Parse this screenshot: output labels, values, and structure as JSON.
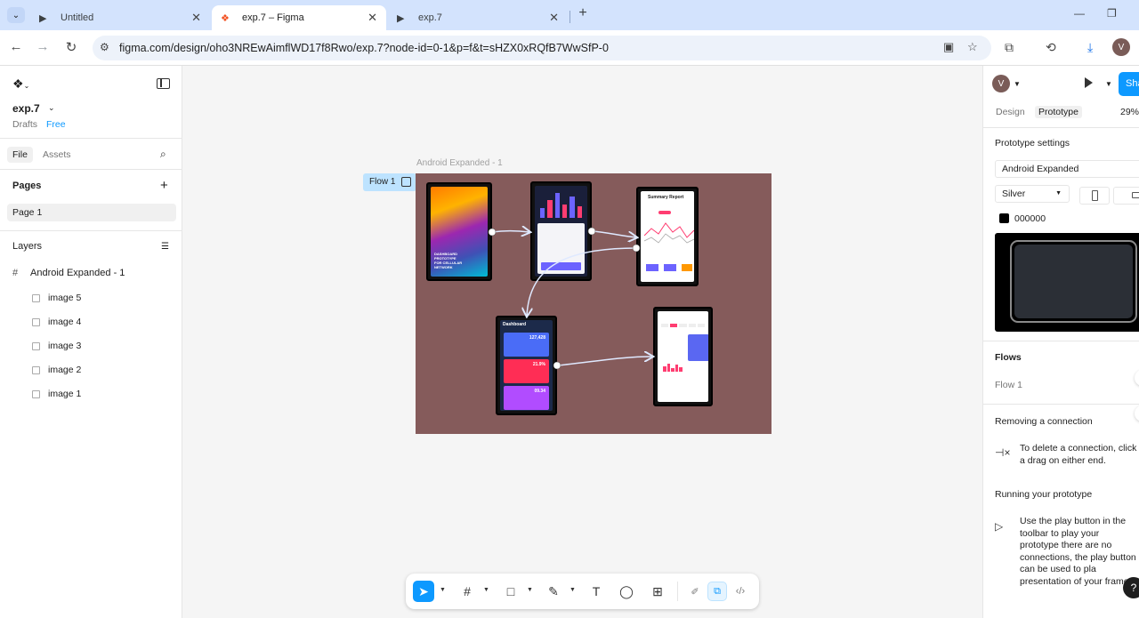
{
  "browser": {
    "tabs": [
      {
        "title": "Untitled",
        "icon": "play-icon"
      },
      {
        "title": "exp.7 – Figma",
        "icon": "figma-icon"
      },
      {
        "title": "exp.7",
        "icon": "play-icon"
      }
    ],
    "url": "figma.com/design/oho3NREwAimflWD17f8Rwo/exp.7?node-id=0-1&p=f&t=sHZX0xRQfB7WwSfP-0",
    "profile_initial": "V"
  },
  "left_panel": {
    "file_name": "exp.7",
    "drafts_label": "Drafts",
    "plan_label": "Free",
    "tabs": {
      "file": "File",
      "assets": "Assets"
    },
    "pages_title": "Pages",
    "pages": [
      "Page 1"
    ],
    "layers_title": "Layers",
    "frame_layer": "Android Expanded - 1",
    "layers": [
      "image 5",
      "image 4",
      "image 3",
      "image 2",
      "image 1"
    ]
  },
  "canvas": {
    "frame_label": "Android Expanded - 1",
    "flow_badge": "Flow 1",
    "frame_color": "#855b5b",
    "screens": {
      "summary_title": "Summary Report",
      "dashboard_title": "Dashboard",
      "dashboard_values": [
        "127,428",
        "21.9%",
        "09.34"
      ]
    }
  },
  "toolbar": {
    "tools": [
      "move-tool",
      "frame-tool",
      "shape-tool",
      "pen-tool",
      "text-tool",
      "comment-tool",
      "actions-tool"
    ],
    "modes": [
      "draw-mode",
      "design-mode",
      "dev-mode"
    ]
  },
  "right_panel": {
    "avatar_initial": "V",
    "share_label": "Sha",
    "tabs": {
      "design": "Design",
      "prototype": "Prototype"
    },
    "zoom": "29%",
    "prototype_settings_title": "Prototype settings",
    "device": "Android Expanded",
    "model": "Silver",
    "background_color": "000000",
    "flows_title": "Flows",
    "flow_item": "Flow 1",
    "removing_title": "Removing a connection",
    "removing_text": "To delete a connection, click a drag on either end.",
    "running_title": "Running your prototype",
    "running_text": "Use the play button in the toolbar to play your prototype there are no connections, the play button can be used to pla presentation of your frames."
  },
  "colors": {
    "accent": "#0d99ff",
    "flow_badge_bg": "#bde3ff",
    "connector": "#ffffff"
  }
}
